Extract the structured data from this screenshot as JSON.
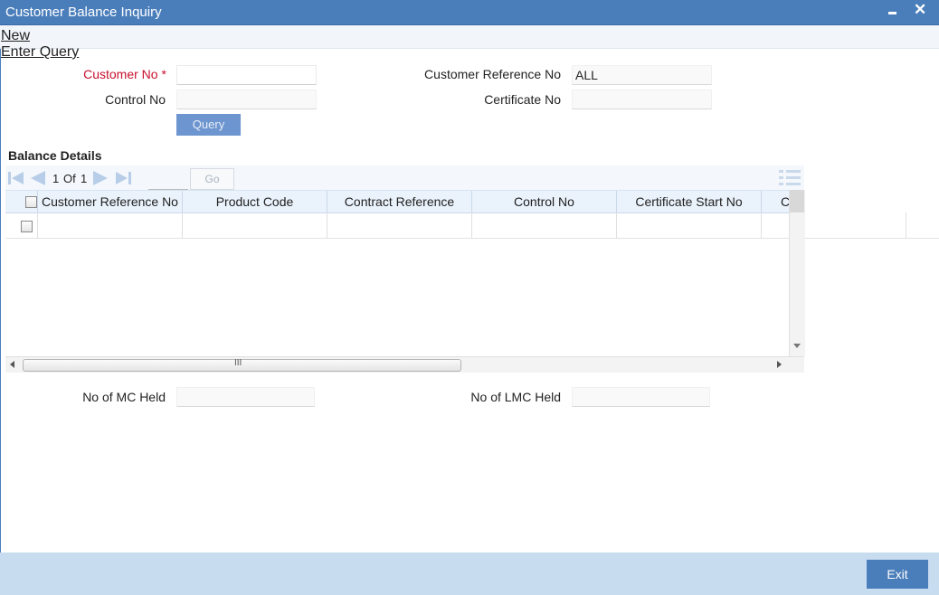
{
  "window": {
    "title": "Customer Balance Inquiry"
  },
  "menu": {
    "new": "New",
    "enter_query": "Enter Query"
  },
  "form": {
    "customer_no_label": "Customer No",
    "required_mark": "*",
    "customer_no_value": "",
    "control_no_label": "Control No",
    "control_no_value": "",
    "customer_ref_label": "Customer Reference No",
    "customer_ref_value": "ALL",
    "certificate_no_label": "Certificate No",
    "certificate_no_value": "",
    "query_label": "Query"
  },
  "grid": {
    "section_title": "Balance Details",
    "page_current": "1",
    "page_of": "Of",
    "page_total": "1",
    "go_label": "Go",
    "columns": [
      "Customer Reference No",
      "Product Code",
      "Contract Reference",
      "Control No",
      "Certificate Start No",
      "C"
    ],
    "h_scroll_mark": "III"
  },
  "totals": {
    "mc_label": "No of MC Held",
    "mc_value": "",
    "lmc_label": "No of LMC Held",
    "lmc_value": ""
  },
  "footer": {
    "exit_label": "Exit"
  },
  "colors": {
    "titlebar": "#4a7ebb",
    "footer": "#c7dcef",
    "required": "#c8102e",
    "query_button": "#6d95cf"
  },
  "icons": [
    "minimize-icon",
    "close-icon",
    "first-page-icon",
    "prev-page-icon",
    "next-page-icon",
    "last-page-icon",
    "column-list-icon",
    "scroll-left-icon",
    "scroll-right-icon",
    "scroll-down-icon"
  ]
}
